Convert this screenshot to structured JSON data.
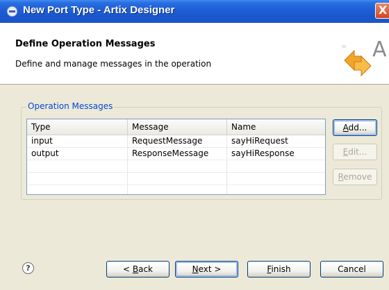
{
  "window": {
    "title": "New Port Type - Artix Designer",
    "close_label": "X"
  },
  "header": {
    "title": "Define Operation Messages",
    "description": "Define and manage messages in the operation",
    "graphic_letter": "A"
  },
  "group": {
    "legend": "Operation Messages"
  },
  "table": {
    "columns": [
      "Type",
      "Message",
      "Name"
    ],
    "rows": [
      [
        "input",
        "RequestMessage",
        "sayHiRequest"
      ],
      [
        "output",
        "ResponseMessage",
        "sayHiResponse"
      ]
    ]
  },
  "side_buttons": {
    "add": {
      "before": "",
      "mnemonic": "A",
      "after": "dd..."
    },
    "edit": {
      "before": "",
      "mnemonic": "E",
      "after": "dit..."
    },
    "remove": {
      "before": "",
      "mnemonic": "R",
      "after": "emove"
    }
  },
  "footer": {
    "help": "?",
    "back": {
      "before": "< ",
      "mnemonic": "B",
      "after": "ack"
    },
    "next": {
      "before": "",
      "mnemonic": "N",
      "after": "ext >"
    },
    "finish": {
      "before": "",
      "mnemonic": "F",
      "after": "inish"
    },
    "cancel": "Cancel"
  },
  "colors": {
    "titlebar": "#1f5fd6",
    "legend": "#0046d5",
    "graphic_arrow": "#f2a52a"
  },
  "icons": {
    "title": "window-app-icon",
    "help": "help-icon",
    "graphic": "swap-arrows-icon"
  }
}
